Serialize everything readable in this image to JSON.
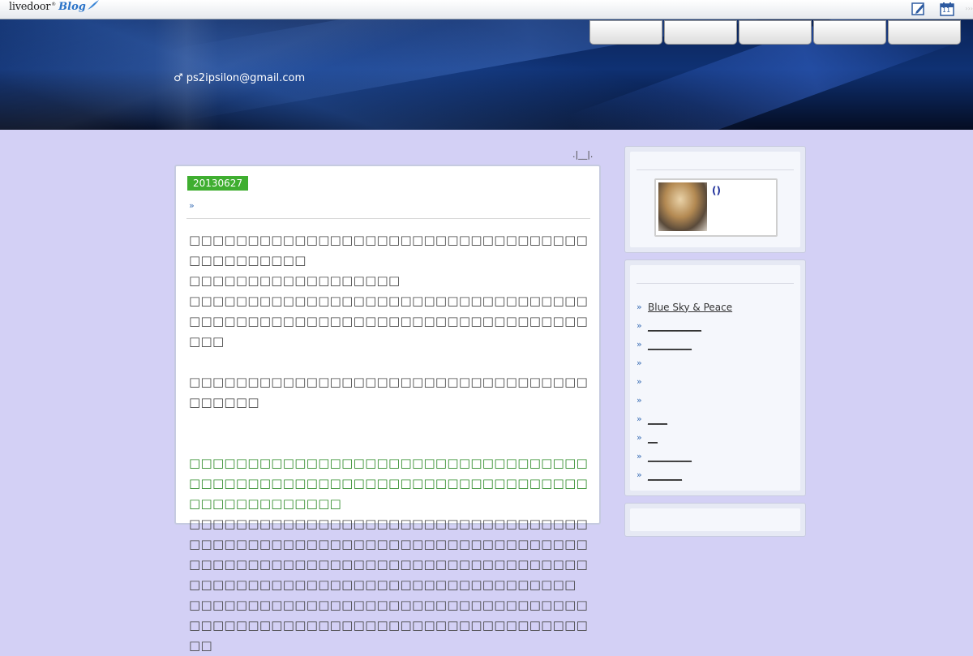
{
  "brand": {
    "live": "livedoor",
    "tm": "®",
    "blog": "Blog"
  },
  "toolbar": {
    "icons": [
      "edit-icon",
      "calendar-icon"
    ],
    "calendar_day": "11",
    "more": "›››"
  },
  "header": {
    "email": "♂ ps2ipsilon@gmail.com",
    "nav_tabs": [
      "",
      "",
      "",
      "",
      ""
    ]
  },
  "breadcrumb": ".|__|.",
  "article": {
    "date": "20130627",
    "title_marker": "»",
    "paragraphs": [
      {
        "color": "normal",
        "text": "□□□□□□□□□□□□□□□□□□□□□□□□□□□□□□□□□□□□□□□□□□□□\n□□□□□□□□□□□□□□□□□□"
      },
      {
        "color": "normal",
        "text": "□□□□□□□□□□□□□□□□□□□□□□□□□□□□□□□□□□□□□□□□□□□□□□□□□□□□□□□□□□□□□□□□□□□□□□□"
      },
      {
        "color": "normal",
        "text": "\n□□□□□□□□□□□□□□□□□□□□□□□□□□□□□□□□□□□□□□□□"
      },
      {
        "color": "normal",
        "text": "\n\n"
      },
      {
        "color": "green",
        "text": "□□□□□□□□□□□□□□□□□□□□□□□□□□□□□□□□□□□□□□□□□□□□□□□□□□□□□□□□□□□□□□□□□□□□□□□□□□□□□□□□□"
      },
      {
        "color": "normal",
        "text": "□□□□□□□□□□□□□□□□□□□□□□□□□□□□□□□□□□□□□□□□□□□□□□□□□□□□□□□□□□□□□□□□□□□□□□□□□□□□□□□□□□□□□□□□□□□□□□□□□□□□□□□□□□□□□□□□□□□□□□□□□□□□□□□□□□□□□□□"
      },
      {
        "color": "normal",
        "text": "□□□□□□□□□□□□□□□□□□□□□□□□□□□□□□□□□□□□□□□□□□□□□□□□□□□□□□□□□□□□□□□□□□□□□□"
      }
    ]
  },
  "sidebar": {
    "profile": {
      "name": "()"
    },
    "links": [
      "Blue Sky & Peace",
      "___________",
      "_________",
      "",
      "",
      "",
      "____",
      "__",
      "_________",
      "_______"
    ],
    "link_marker": "»"
  },
  "colors": {
    "page_bg": "#d3d0f5",
    "header_bg": "#0f3173",
    "date_badge": "#3fae30",
    "green_text": "#2e8b27",
    "profile_name": "#1f2f9a"
  }
}
